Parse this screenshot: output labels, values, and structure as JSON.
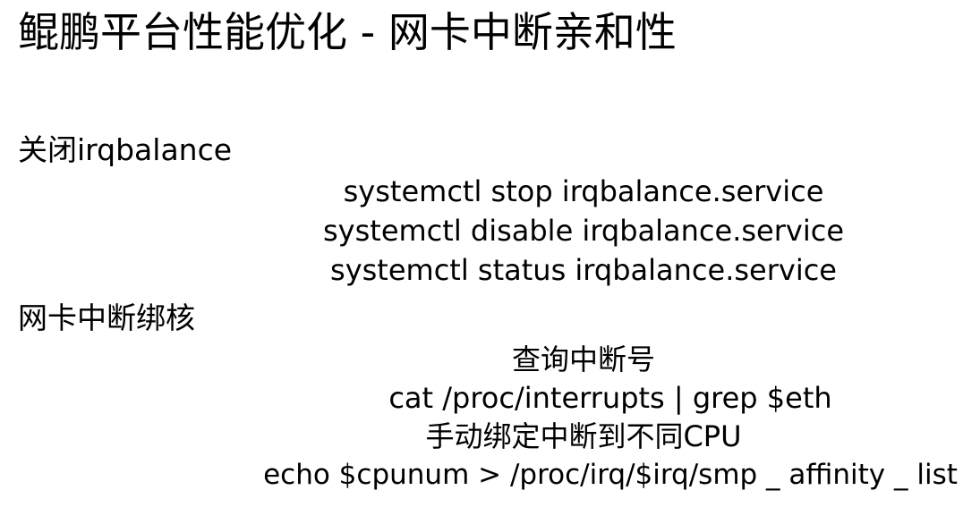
{
  "title": "鲲鹏平台性能优化 - 网卡中断亲和性",
  "sections": [
    {
      "heading": "关闭irqbalance",
      "lines": [
        "systemctl stop irqbalance.service",
        "systemctl disable irqbalance.service",
        "systemctl status irqbalance.service"
      ]
    },
    {
      "heading": "网卡中断绑核",
      "lines": [
        "查询中断号",
        "cat /proc/interrupts | grep $eth",
        "手动绑定中断到不同CPU",
        "echo $cpunum > /proc/irq/$irq/smp _ affinity _ list"
      ]
    }
  ]
}
